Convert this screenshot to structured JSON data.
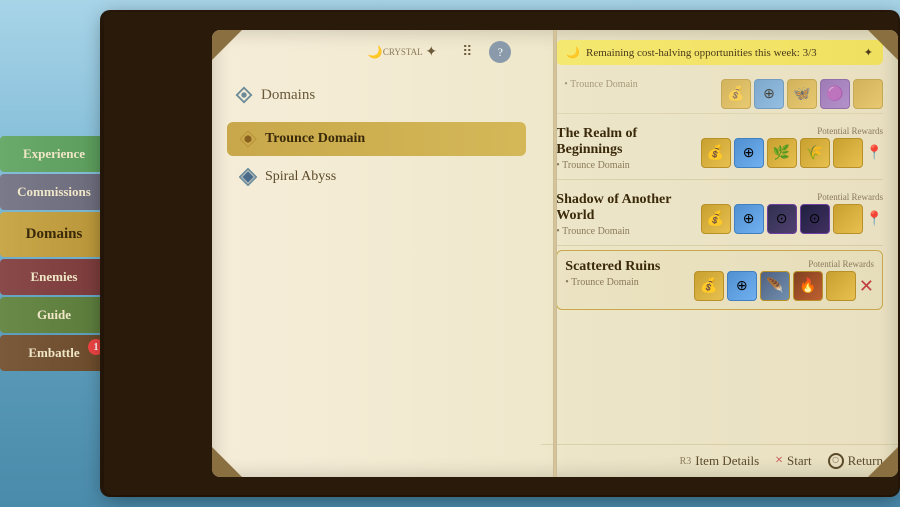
{
  "sidebar": {
    "items": [
      {
        "id": "experience",
        "label": "Experience",
        "class": "experience"
      },
      {
        "id": "commissions",
        "label": "Commissions",
        "class": "commissions"
      },
      {
        "id": "domains",
        "label": "Domains",
        "class": "domains",
        "active": true
      },
      {
        "id": "enemies",
        "label": "Enemies",
        "class": "enemies"
      },
      {
        "id": "guide",
        "label": "Guide",
        "class": "guide"
      },
      {
        "id": "embattle",
        "label": "Embattle",
        "class": "embattle",
        "badge": "1"
      }
    ]
  },
  "nav": {
    "domains_label": "Domains",
    "trounce_domain_label": "Trounce Domain",
    "spiral_abyss_label": "Spiral Abyss"
  },
  "notification": {
    "text": "Remaining cost-halving opportunities this week: 3/3"
  },
  "domains": [
    {
      "id": "realm-of-beginnings",
      "name": "The Realm of Beginnings",
      "type": "Trounce Domain",
      "potential_rewards": true,
      "highlighted": false
    },
    {
      "id": "shadow-of-another-world",
      "name": "Shadow of Another World",
      "type": "Trounce Domain",
      "potential_rewards": true,
      "highlighted": false
    },
    {
      "id": "scattered-ruins",
      "name": "Scattered Ruins",
      "type": "Trounce Domain",
      "potential_rewards": true,
      "highlighted": true
    }
  ],
  "bottom_bar": {
    "item_details_key": "R3",
    "item_details_label": "Item Details",
    "start_key": "×",
    "start_label": "Start",
    "return_key": "○",
    "return_label": "Return"
  },
  "potential_rewards_label": "Potential Rewards",
  "icons": {
    "moon": "🌙",
    "snowflake": "✦",
    "dots": "⠿",
    "question": "?",
    "location": "♥",
    "close": "✕"
  }
}
